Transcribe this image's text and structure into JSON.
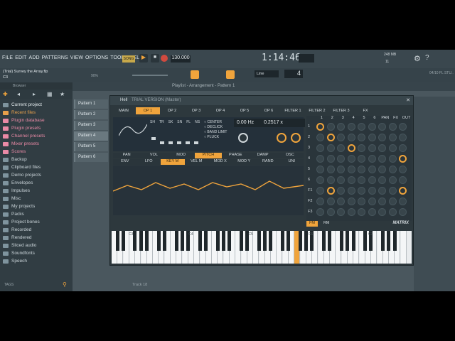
{
  "menu": [
    "FILE",
    "EDIT",
    "ADD",
    "PATTERNS",
    "VIEW",
    "OPTIONS",
    "TOOLS",
    "HELP"
  ],
  "project_title": "(Trial) Survey the Array.flp",
  "project_subtitle": "C3",
  "zoom": "90%",
  "song_label": "SONG",
  "bpm": "130.000",
  "time": "1:14:46",
  "mode_label": "Line",
  "step_value": "4",
  "memory": "248 MB",
  "memory_count": "11",
  "fl_label": "04/10  FL STU..",
  "browser": {
    "title": "Browser",
    "items": [
      {
        "label": "Current project",
        "style": "hl"
      },
      {
        "label": "Recent files",
        "style": "orange"
      },
      {
        "label": "Plugin database",
        "style": "pink"
      },
      {
        "label": "Plugin presets",
        "style": "pink"
      },
      {
        "label": "Channel presets",
        "style": "pink"
      },
      {
        "label": "Mixer presets",
        "style": "pink"
      },
      {
        "label": "Scores",
        "style": "pink"
      },
      {
        "label": "Backup",
        "style": ""
      },
      {
        "label": "Clipboard files",
        "style": ""
      },
      {
        "label": "Demo projects",
        "style": ""
      },
      {
        "label": "Envelopes",
        "style": ""
      },
      {
        "label": "Impulses",
        "style": ""
      },
      {
        "label": "Misc",
        "style": ""
      },
      {
        "label": "My projects",
        "style": ""
      },
      {
        "label": "Packs",
        "style": ""
      },
      {
        "label": "Project bones",
        "style": ""
      },
      {
        "label": "Recorded",
        "style": ""
      },
      {
        "label": "Rendered",
        "style": ""
      },
      {
        "label": "Sliced audio",
        "style": ""
      },
      {
        "label": "Soundfonts",
        "style": ""
      },
      {
        "label": "Speech",
        "style": ""
      }
    ],
    "tags_label": "TAGS"
  },
  "playlist_label": "Playlist - Arrangement - Pattern 1",
  "track_label": "Track 18",
  "patterns": [
    "Pattern 1",
    "Pattern 2",
    "Pattern 3",
    "Pattern 4",
    "Pattern 5",
    "Pattern 6"
  ],
  "plugin": {
    "title": "Hell",
    "subtitle": "TRIAL VERSION (Master)",
    "tabs": [
      "MAIN",
      "OP 1",
      "OP 2",
      "OP 3",
      "OP 4",
      "OP 5",
      "OP 6",
      "FILTER 1",
      "FILTER 2",
      "FILTER 3",
      "FX"
    ],
    "active_tab": 1,
    "freq_display": "0.00 Hz",
    "ratio_display": "0.2517 x",
    "mod_row1": [
      "PAN",
      "VOL",
      "MOD",
      "PITCH",
      "PHASE",
      "DAMP",
      "OSC"
    ],
    "mod_row1_active": 3,
    "mod_row2": [
      "ENV",
      "LFO",
      "KEY M",
      "VEL M",
      "MOD X",
      "MOD Y",
      "RAND",
      "UNI"
    ],
    "mod_row2_active": 2,
    "center_labels": [
      "CENTER",
      "DECLICK",
      "BAND LIMIT",
      "PLUCK"
    ],
    "knob_labels": [
      "PHASE",
      "GLOBAL",
      "VOL",
      "PE"
    ],
    "osc_labels": [
      "SH",
      "TR",
      "SK",
      "SN",
      "FL",
      "NS"
    ],
    "matrix_cols": [
      "1",
      "2",
      "3",
      "4",
      "5",
      "6",
      "PAN",
      "FX",
      "OUT"
    ],
    "matrix_rows": [
      "1",
      "2",
      "3",
      "4",
      "5",
      "6",
      "F1",
      "F2",
      "F3"
    ],
    "fm_label": "FM",
    "rm_label": "RM",
    "matrix_label": "MATRIX",
    "octave_labels": [
      "C3",
      "C4",
      "C5",
      "C6",
      "C7"
    ]
  },
  "colors": {
    "accent": "#f0a43c",
    "bg": "#3d4a51"
  }
}
